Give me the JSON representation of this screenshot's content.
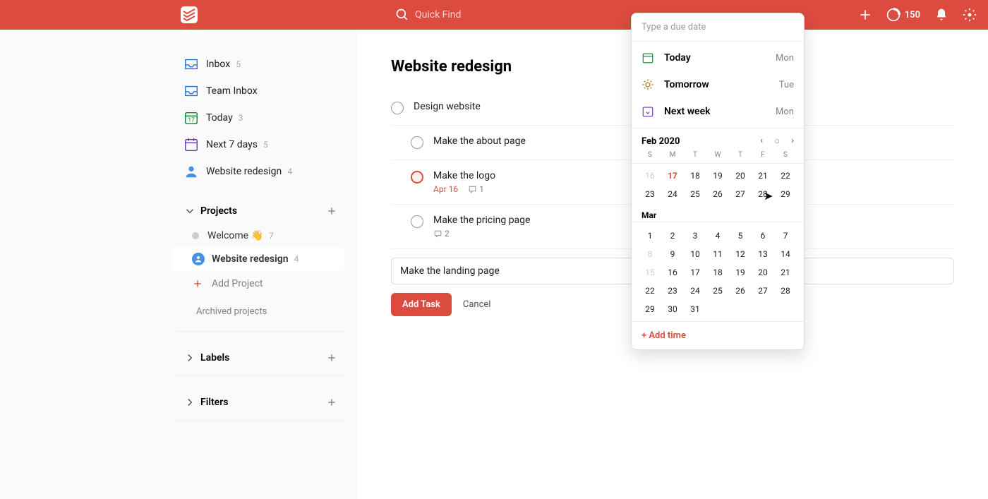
{
  "topbar": {
    "search_placeholder": "Quick Find",
    "karma": "150"
  },
  "sidebar": {
    "inbox": {
      "label": "Inbox",
      "count": "5"
    },
    "team_inbox": {
      "label": "Team Inbox"
    },
    "today": {
      "label": "Today",
      "count": "3"
    },
    "next7": {
      "label": "Next 7 days",
      "count": "5"
    },
    "website_redesign_top": {
      "label": "Website redesign",
      "count": "4"
    },
    "projects_header": "Projects",
    "welcome": {
      "label": "Welcome 👋",
      "count": "7"
    },
    "website_redesign": {
      "label": "Website redesign",
      "count": "4"
    },
    "add_project": "Add Project",
    "archived": "Archived projects",
    "labels_header": "Labels",
    "filters_header": "Filters"
  },
  "main": {
    "title": "Website redesign",
    "tasks": [
      {
        "title": "Design website"
      },
      {
        "title": "Make the about page"
      },
      {
        "title": "Make the logo",
        "date": "Apr 16",
        "comments": "1",
        "priority": true
      },
      {
        "title": "Make the pricing page",
        "comments": "2"
      }
    ],
    "new_task": "Make the landing page",
    "add_button": "Add Task",
    "cancel_button": "Cancel"
  },
  "datepicker": {
    "input_placeholder": "Type a due date",
    "shortcuts": [
      {
        "label": "Today",
        "day": "Mon",
        "color": "#058527"
      },
      {
        "label": "Tomorrow",
        "day": "Tue",
        "color": "#ad6200"
      },
      {
        "label": "Next week",
        "day": "Mon",
        "color": "#692ec2"
      }
    ],
    "month1": "Feb 2020",
    "weekdays": [
      "S",
      "M",
      "T",
      "W",
      "T",
      "F",
      "S"
    ],
    "feb_rows": [
      [
        {
          "d": "16",
          "muted": true
        },
        {
          "d": "17",
          "today": true
        },
        {
          "d": "18"
        },
        {
          "d": "19"
        },
        {
          "d": "20"
        },
        {
          "d": "21"
        },
        {
          "d": "22"
        }
      ],
      [
        {
          "d": "23"
        },
        {
          "d": "24"
        },
        {
          "d": "25"
        },
        {
          "d": "26"
        },
        {
          "d": "27"
        },
        {
          "d": "28"
        },
        {
          "d": "29"
        }
      ]
    ],
    "month2": "Mar",
    "mar_rows": [
      [
        {
          "d": "1"
        },
        {
          "d": "2"
        },
        {
          "d": "3"
        },
        {
          "d": "4"
        },
        {
          "d": "5"
        },
        {
          "d": "6"
        },
        {
          "d": "7"
        }
      ],
      [
        {
          "d": "8",
          "muted": true
        },
        {
          "d": "9"
        },
        {
          "d": "10"
        },
        {
          "d": "11"
        },
        {
          "d": "12"
        },
        {
          "d": "13"
        },
        {
          "d": "14"
        }
      ],
      [
        {
          "d": "15",
          "muted": true
        },
        {
          "d": "16"
        },
        {
          "d": "17"
        },
        {
          "d": "18"
        },
        {
          "d": "19"
        },
        {
          "d": "20"
        },
        {
          "d": "21"
        }
      ],
      [
        {
          "d": "22"
        },
        {
          "d": "23"
        },
        {
          "d": "24"
        },
        {
          "d": "25"
        },
        {
          "d": "26"
        },
        {
          "d": "27"
        },
        {
          "d": "28"
        }
      ],
      [
        {
          "d": "29"
        },
        {
          "d": "30"
        },
        {
          "d": "31"
        },
        {
          "d": ""
        },
        {
          "d": ""
        },
        {
          "d": ""
        },
        {
          "d": ""
        }
      ]
    ],
    "add_time": "+ Add time"
  }
}
